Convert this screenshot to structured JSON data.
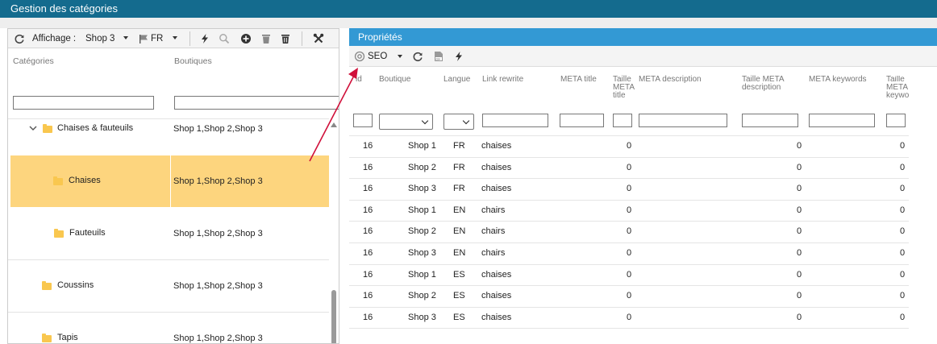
{
  "window": {
    "title": "Gestion des catégories"
  },
  "left_toolbar": {
    "display_label": "Affichage :",
    "shop_value": "Shop 3",
    "lang_value": "FR"
  },
  "tree": {
    "headers": {
      "categories": "Catégories",
      "shops": "Boutiques"
    },
    "rows": [
      {
        "label": "Chaises & fauteuils",
        "shops": "Shop 1,Shop 2,Shop 3",
        "expanded": true,
        "selected": false
      },
      {
        "label": "Chaises",
        "shops": "Shop 1,Shop 2,Shop 3",
        "selected": true
      },
      {
        "label": "Fauteuils",
        "shops": "Shop 1,Shop 2,Shop 3",
        "selected": false
      },
      {
        "label": "Coussins",
        "shops": "Shop 1,Shop 2,Shop 3",
        "selected": false
      },
      {
        "label": "Tapis",
        "shops": "Shop 1,Shop 2,Shop 3",
        "selected": false
      }
    ]
  },
  "properties": {
    "title": "Propriétés",
    "toolbar": {
      "view_value": "SEO"
    },
    "columns": {
      "id": "id",
      "shop": "Boutique",
      "lang": "Langue",
      "link_rewrite": "Link rewrite",
      "meta_title": "META title",
      "meta_title_size": [
        "Taille",
        "META",
        "title"
      ],
      "meta_description": "META description",
      "meta_description_size": [
        "Taille META",
        "description"
      ],
      "meta_keywords": "META keywords",
      "meta_keywords_size": [
        "Taille",
        "META",
        "keywo"
      ]
    },
    "rows": [
      {
        "id": "16",
        "shop": "Shop 1",
        "lang": "FR",
        "link_rewrite": "chaises",
        "title_size": "0",
        "desc_size": "0",
        "kw_size": "0"
      },
      {
        "id": "16",
        "shop": "Shop 2",
        "lang": "FR",
        "link_rewrite": "chaises",
        "title_size": "0",
        "desc_size": "0",
        "kw_size": "0"
      },
      {
        "id": "16",
        "shop": "Shop 3",
        "lang": "FR",
        "link_rewrite": "chaises",
        "title_size": "0",
        "desc_size": "0",
        "kw_size": "0"
      },
      {
        "id": "16",
        "shop": "Shop 1",
        "lang": "EN",
        "link_rewrite": "chairs",
        "title_size": "0",
        "desc_size": "0",
        "kw_size": "0"
      },
      {
        "id": "16",
        "shop": "Shop 2",
        "lang": "EN",
        "link_rewrite": "chairs",
        "title_size": "0",
        "desc_size": "0",
        "kw_size": "0"
      },
      {
        "id": "16",
        "shop": "Shop 3",
        "lang": "EN",
        "link_rewrite": "chairs",
        "title_size": "0",
        "desc_size": "0",
        "kw_size": "0"
      },
      {
        "id": "16",
        "shop": "Shop 1",
        "lang": "ES",
        "link_rewrite": "chaises",
        "title_size": "0",
        "desc_size": "0",
        "kw_size": "0"
      },
      {
        "id": "16",
        "shop": "Shop 2",
        "lang": "ES",
        "link_rewrite": "chaises",
        "title_size": "0",
        "desc_size": "0",
        "kw_size": "0"
      },
      {
        "id": "16",
        "shop": "Shop 3",
        "lang": "ES",
        "link_rewrite": "chaises",
        "title_size": "0",
        "desc_size": "0",
        "kw_size": "0"
      }
    ]
  },
  "colors": {
    "title_bar": "#146b8e",
    "panel_header": "#3399d4",
    "selection": "#fdd57e",
    "folder": "#f9c74f",
    "annotation_arrow": "#d0103a"
  }
}
